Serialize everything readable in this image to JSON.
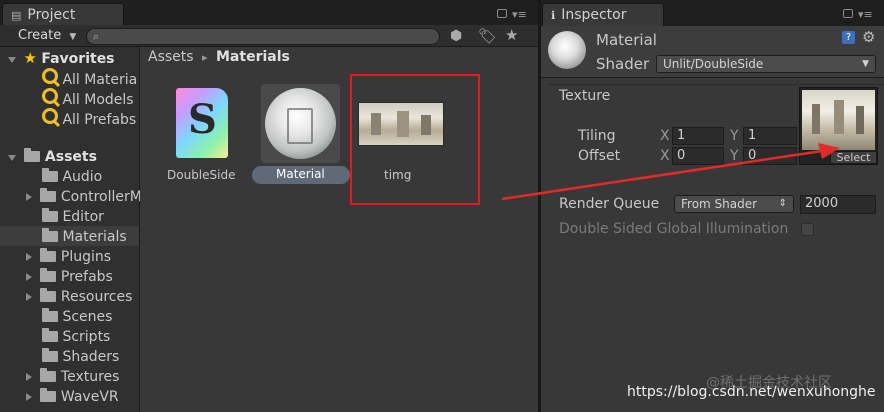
{
  "project": {
    "tab_label": "Project",
    "create_label": "Create",
    "breadcrumb_root": "Assets",
    "breadcrumb_sep": "▸",
    "breadcrumb_current": "Materials",
    "favorites": {
      "label": "Favorites",
      "items": [
        "All Materia",
        "All Models",
        "All Prefabs"
      ]
    },
    "assets": {
      "label": "Assets",
      "folders": [
        "Audio",
        "ControllerM",
        "Editor",
        "Materials",
        "Plugins",
        "Prefabs",
        "Resources",
        "Scenes",
        "Scripts",
        "Shaders",
        "Textures",
        "WaveVR"
      ]
    },
    "files": [
      {
        "name": "DoubleSide",
        "icon": "shader-icon"
      },
      {
        "name": "Material",
        "icon": "material-icon"
      },
      {
        "name": "timg",
        "icon": "texture-icon"
      }
    ]
  },
  "inspector": {
    "tab_label": "Inspector",
    "material_name": "Material",
    "shader_label": "Shader",
    "shader_value": "Unlit/DoubleSide",
    "texture_label": "Texture",
    "tiling_label": "Tiling",
    "offset_label": "Offset",
    "tiling_x": "1",
    "tiling_y": "1",
    "offset_x": "0",
    "offset_y": "0",
    "x_label": "X",
    "y_label": "Y",
    "select_label": "Select",
    "render_queue_label": "Render Queue",
    "render_queue_mode": "From Shader",
    "render_queue_value": "2000",
    "dsgi_label": "Double Sided Global Illumination"
  },
  "watermark": "https://blog.csdn.net/wenxuhonghe",
  "watermark2": "@稀土掘金技术社区",
  "colors": {
    "highlight_box": "#e01b22",
    "arrow": "#e22a2a",
    "favorites_star": "#f5c518"
  }
}
